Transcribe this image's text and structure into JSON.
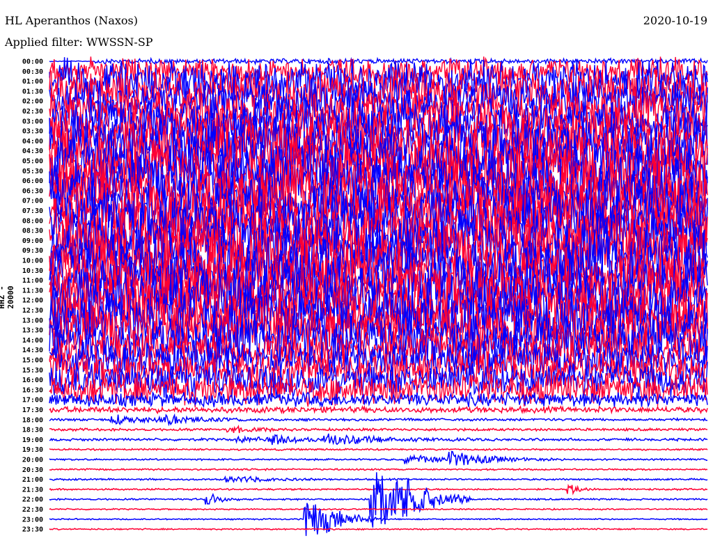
{
  "header": {
    "station": "HL Aperanthos (Naxos)",
    "filter": "Applied filter: WWSSN-SP",
    "date": "2020-10-19",
    "channel": "HHZ - 20000"
  },
  "chart_data": {
    "type": "line",
    "title": "HL Aperanthos (Naxos)",
    "subtitle": "Applied filter: WWSSN-SP",
    "ylabel": "HHZ - 20000",
    "minutes_per_row": 30,
    "row_labels": [
      "00:00",
      "00:30",
      "01:00",
      "01:30",
      "02:00",
      "02:30",
      "03:00",
      "03:30",
      "04:00",
      "04:30",
      "05:00",
      "05:30",
      "06:00",
      "06:30",
      "07:00",
      "07:30",
      "08:00",
      "08:30",
      "09:00",
      "09:30",
      "10:00",
      "10:30",
      "11:00",
      "11:30",
      "12:00",
      "12:30",
      "13:00",
      "13:30",
      "14:00",
      "14:30",
      "15:00",
      "15:30",
      "16:00",
      "16:30",
      "17:00",
      "17:30",
      "18:00",
      "18:30",
      "19:00",
      "19:30",
      "20:00",
      "20:30",
      "21:00",
      "21:30",
      "22:00",
      "22:30",
      "23:00",
      "23:30"
    ],
    "colors": [
      "#0000ff",
      "#ff0033"
    ],
    "noise_amplitude_rel": [
      0.05,
      1.5,
      2.5,
      2.5,
      2.5,
      2.5,
      2.8,
      3,
      3.2,
      3.5,
      3.5,
      3.5,
      3.5,
      3.5,
      3.5,
      3.5,
      3.5,
      3.5,
      3.5,
      3.5,
      3.5,
      3.5,
      3.5,
      3.5,
      3.5,
      3.5,
      3.2,
      3,
      2.8,
      2.5,
      2.2,
      2,
      2,
      1.8,
      0.8,
      0.35,
      0.15,
      0.15,
      0.15,
      0.1,
      0.1,
      0.1,
      0.1,
      0.1,
      0.1,
      0.08,
      0.08,
      0.08
    ],
    "events": [
      {
        "row": 36,
        "minute": 2.8,
        "duration": 2,
        "amp": 0.5
      },
      {
        "row": 36,
        "minute": 5.3,
        "duration": 1.5,
        "amp": 0.4
      },
      {
        "row": 37,
        "minute": 8.2,
        "duration": 1,
        "amp": 0.4
      },
      {
        "row": 38,
        "minute": 8.6,
        "duration": 1,
        "amp": 0.35
      },
      {
        "row": 38,
        "minute": 10.2,
        "duration": 1.2,
        "amp": 0.5
      },
      {
        "row": 38,
        "minute": 12.6,
        "duration": 2.2,
        "amp": 0.7
      },
      {
        "row": 40,
        "minute": 16.3,
        "duration": 1.5,
        "amp": 0.6
      },
      {
        "row": 40,
        "minute": 18.3,
        "duration": 1.8,
        "amp": 0.8
      },
      {
        "row": 42,
        "minute": 8.1,
        "duration": 1.5,
        "amp": 0.5
      },
      {
        "row": 43,
        "minute": 23.7,
        "duration": 0.5,
        "amp": 0.6
      },
      {
        "row": 44,
        "minute": 7.2,
        "duration": 0.5,
        "amp": 0.8
      },
      {
        "row": 44,
        "minute": 14.7,
        "duration": 1.5,
        "amp": 7
      },
      {
        "row": 46,
        "minute": 11.7,
        "duration": 1.2,
        "amp": 3
      }
    ]
  }
}
